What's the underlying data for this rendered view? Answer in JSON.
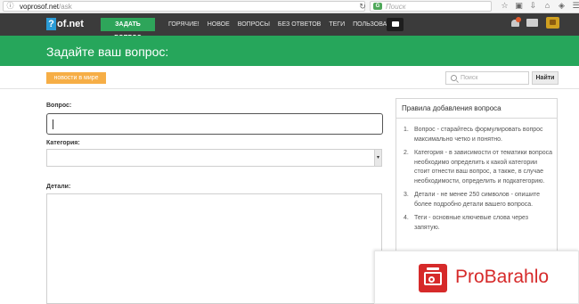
{
  "browser": {
    "url_host": "voprosof.net",
    "url_path": "/ask",
    "search_placeholder": "Поиск",
    "reload_icon": "reload-icon",
    "info_icon": "info-icon"
  },
  "header": {
    "logo_mark": "?",
    "logo_text": "of.net",
    "ask_button": "ЗАДАТЬ ВОПРОС",
    "nav": [
      "ГОРЯЧИЕ!",
      "НОВОЕ",
      "ВОПРОСЫ",
      "БЕЗ ОТВЕТОВ",
      "ТЕГИ",
      "ПОЛЬЗОВАТЕЛИ"
    ],
    "notification_color": "#e25b2d"
  },
  "title_band": {
    "title": "Задайте ваш вопрос:",
    "color": "#26a65b"
  },
  "sub_bar": {
    "news_button": "новости в мире",
    "search_placeholder": "Поиск",
    "find_button": "Найти"
  },
  "form": {
    "question_label": "Вопрос:",
    "question_value": "",
    "category_label": "Категория:",
    "category_value": "",
    "details_label": "Детали:",
    "details_value": ""
  },
  "rules": {
    "title": "Правила добавления вопроса",
    "items": [
      {
        "num": "1.",
        "text": "Вопрос - старайтесь формулировать вопрос максимально четко и понятно."
      },
      {
        "num": "2.",
        "text": "Категория - в зависимости от тематики вопроса необходимо определить к какой категории стоит отнести ваш вопрос, а также, в случае необходимости, определить и подкатегорию."
      },
      {
        "num": "3.",
        "text": "Детали - не менее 250 символов - опишите более подробно детали вашего вопроса."
      },
      {
        "num": "4.",
        "text": "Теги - основные ключевые слова через запятую."
      }
    ]
  },
  "ad": {
    "brand": "ProBarahlo",
    "brand_color": "#d62a2a"
  }
}
